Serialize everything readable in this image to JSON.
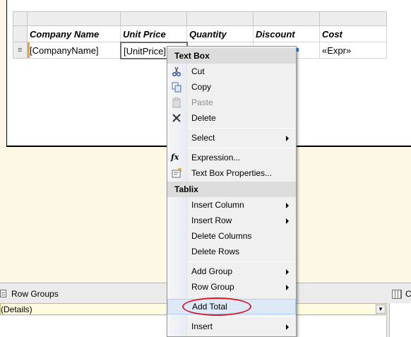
{
  "tablix": {
    "headers": [
      "Company Name",
      "Unit Price",
      "Quantity",
      "Discount",
      "Cost"
    ],
    "values": [
      "[CompanyName]",
      "[UnitPrice]",
      "",
      "",
      "«Expr»"
    ],
    "row_handle_glyph": "≡"
  },
  "context_menu": {
    "text_box_header": "Text Box",
    "cut": "Cut",
    "copy": "Copy",
    "paste": "Paste",
    "delete": "Delete",
    "select": "Select",
    "expression": "Expression...",
    "text_box_properties": "Text Box Properties...",
    "tablix_header": "Tablix",
    "insert_column": "Insert Column",
    "insert_row": "Insert Row",
    "delete_columns": "Delete Columns",
    "delete_rows": "Delete Rows",
    "add_group": "Add Group",
    "row_group": "Row Group",
    "add_total": "Add Total",
    "insert": "Insert"
  },
  "grouping_pane": {
    "row_groups_label": "Row Groups",
    "details_label": "(Details)",
    "column_groups_label_fragment": "C"
  },
  "colors": {
    "highlight_oval": "#d4202a",
    "menu_highlight": "#dde9f7",
    "report_background": "#fdf8e6"
  }
}
